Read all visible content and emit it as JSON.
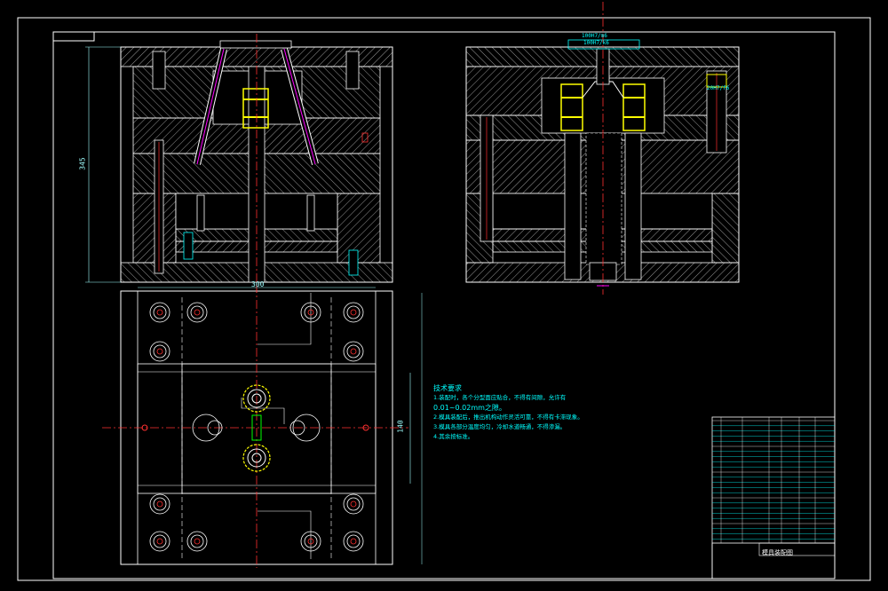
{
  "drawing": {
    "dims": {
      "overall_height": "345",
      "plate_width": "300",
      "right_height": "140",
      "sprue_tag_1": "100H7/m6",
      "sprue_tag_2": "100H7/k6",
      "pin_tag": "20H7/f6"
    },
    "notes": {
      "title": "技术要求",
      "lines": [
        "1.装配时，各个分型面应贴合，不得有间隙，允许有",
        "0.01~0.02mm之隙。",
        "2.模具装配后，推出机构动作灵活可靠，不得有卡滞现象。",
        "3.模具各部分温度均匀，冷却水道畅通，不得渗漏。",
        "4.其余按标准。"
      ]
    },
    "title_block": {
      "name": "模具装配图"
    },
    "colors": {
      "frame": "#ffffff",
      "line": "#ffffff",
      "center": "#ff3030",
      "yellow": "#ffff00",
      "cyan": "#00ffff",
      "magenta": "#ff00ff",
      "green": "#00ff00"
    }
  }
}
